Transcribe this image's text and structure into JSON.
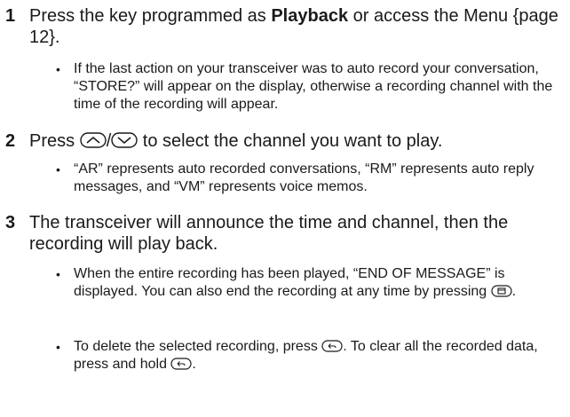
{
  "steps": [
    {
      "number": "1",
      "text_before": "Press the key programmed as ",
      "text_bold": "Playback",
      "text_after": " or access the Menu {page 12}.",
      "bullets": [
        "If the last action on your transceiver was to auto record your conversation, “STORE?” will appear on the display, otherwise a recording channel with the time of the recording will appear."
      ]
    },
    {
      "number": "2",
      "text_before": "Press ",
      "separator": "/",
      "text_after": " to select the channel you want to play.",
      "icons": [
        "up-key-icon",
        "down-key-icon"
      ],
      "bullets": [
        "“AR” represents auto recorded conversations, “RM” represents auto reply messages, and “VM” represents voice memos."
      ]
    },
    {
      "number": "3",
      "text": "The transceiver will announce the time and channel, then the recording will play back.",
      "bullets": [
        {
          "text": "When the entire recording has been played, “END OF MESSAGE” is displayed.  You can also end the recording at any time by pressing ",
          "end": ".",
          "icon": "menu-key-icon"
        },
        {
          "text_a": "To delete the selected recording, press ",
          "text_b": ".  To clear all the recorded data, press and hold ",
          "end": ".",
          "icon": "back-key-icon"
        }
      ]
    }
  ]
}
